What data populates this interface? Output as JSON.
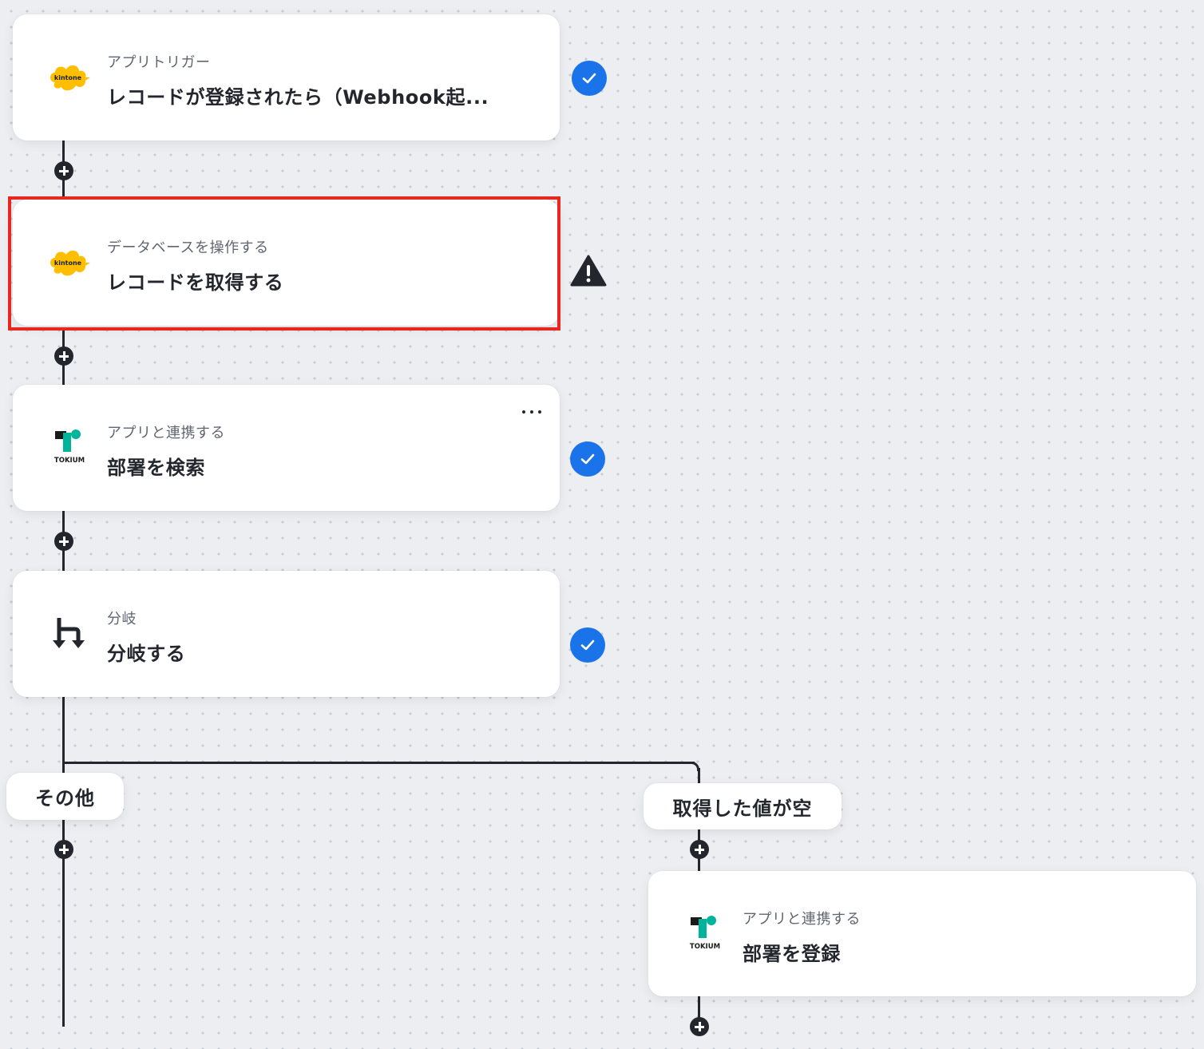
{
  "steps": [
    {
      "subtitle": "アプリトリガー",
      "title": "レコードが登録されたら（Webhook起...",
      "app": "kintone",
      "status": "check"
    },
    {
      "subtitle": "データベースを操作する",
      "title": "レコードを取得する",
      "app": "kintone",
      "status": "warning"
    },
    {
      "subtitle": "アプリと連携する",
      "title": "部署を検索",
      "app": "TOKIUM",
      "status": "check"
    },
    {
      "subtitle": "分岐",
      "title": "分岐する",
      "app": "branch",
      "status": "check"
    }
  ],
  "branches": {
    "left_label": "その他",
    "right_label": "取得した値が空"
  },
  "branch_step": {
    "subtitle": "アプリと連携する",
    "title": "部署を登録",
    "app": "TOKIUM"
  },
  "logos": {
    "kintone": "kintone",
    "tokium": "TOKIUM"
  },
  "colors": {
    "accent": "#1a73e8",
    "highlight": "#e8281f",
    "kintone_yellow": "#ffbe00",
    "tokium_green": "#00b39b"
  }
}
